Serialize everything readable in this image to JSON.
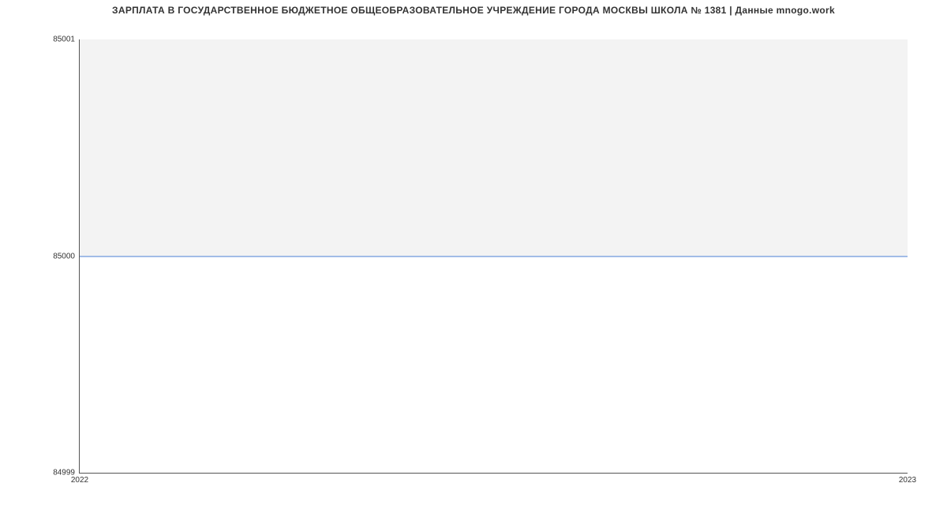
{
  "chart_data": {
    "type": "area",
    "title": "ЗАРПЛАТА В ГОСУДАРСТВЕННОЕ БЮДЖЕТНОЕ ОБЩЕОБРАЗОВАТЕЛЬНОЕ УЧРЕЖДЕНИЕ ГОРОДА МОСКВЫ ШКОЛА № 1381 | Данные mnogo.work",
    "x": [
      2022,
      2023
    ],
    "values": [
      85000,
      85000
    ],
    "xlabel": "",
    "ylabel": "",
    "ylim": [
      84999,
      85001
    ],
    "xlim": [
      2022,
      2023
    ],
    "y_ticks": [
      84999,
      85000,
      85001
    ],
    "x_ticks": [
      2022,
      2023
    ],
    "line_color": "#4a7fd6",
    "fill_color": "#f3f3f3"
  },
  "ticks": {
    "y_top": "85001",
    "y_mid": "85000",
    "y_bot": "84999",
    "x_left": "2022",
    "x_right": "2023"
  }
}
